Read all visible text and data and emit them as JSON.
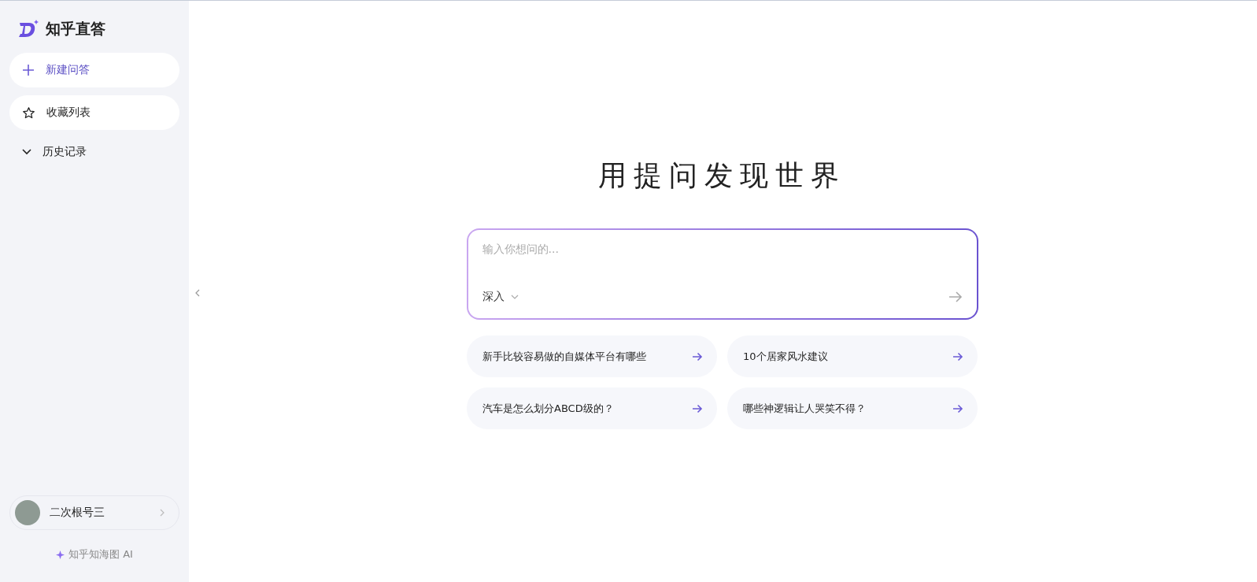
{
  "sidebar": {
    "logo": {
      "title": "知乎直答"
    },
    "items": [
      {
        "kind": "new",
        "label": "新建问答"
      },
      {
        "kind": "link",
        "label": "收藏列表"
      },
      {
        "kind": "section",
        "label": "历史记录"
      }
    ],
    "user": {
      "name": "二次根号三"
    },
    "footer": "知乎知海图 AI"
  },
  "main": {
    "headline": "用提问发现世界",
    "search": {
      "placeholder": "输入你想问的...",
      "mode": "深入"
    },
    "suggestions": [
      "新手比较容易做的自媒体平台有哪些",
      "10个居家风水建议",
      "汽车是怎么划分ABCD级的？",
      "哪些神逻辑让人哭笑不得？"
    ]
  }
}
